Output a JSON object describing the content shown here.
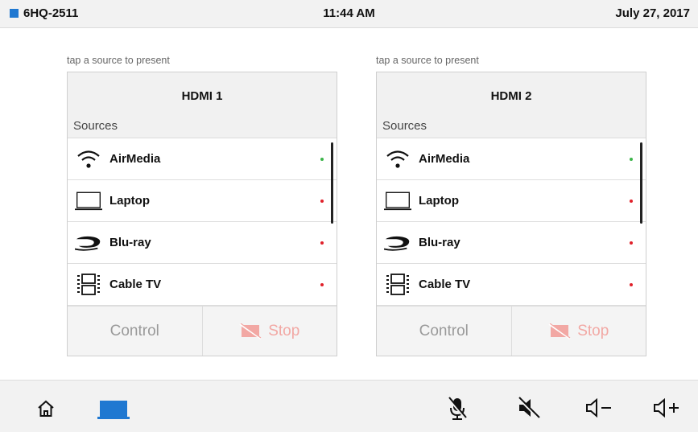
{
  "status_bar": {
    "room_name": "6HQ-2511",
    "time": "11:44 AM",
    "date": "July 27, 2017"
  },
  "panels": [
    {
      "hint": "tap a source to present",
      "title": "HDMI 1",
      "sources_label": "Sources",
      "sources": [
        {
          "label": "AirMedia",
          "icon": "wifi-icon",
          "status": "green"
        },
        {
          "label": "Laptop",
          "icon": "laptop-icon",
          "status": "red"
        },
        {
          "label": "Blu-ray",
          "icon": "bluray-icon",
          "status": "red"
        },
        {
          "label": "Cable TV",
          "icon": "cable-tv-icon",
          "status": "red"
        }
      ],
      "control_label": "Control",
      "stop_label": "Stop"
    },
    {
      "hint": "tap a source to present",
      "title": "HDMI 2",
      "sources_label": "Sources",
      "sources": [
        {
          "label": "AirMedia",
          "icon": "wifi-icon",
          "status": "green"
        },
        {
          "label": "Laptop",
          "icon": "laptop-icon",
          "status": "red"
        },
        {
          "label": "Blu-ray",
          "icon": "bluray-icon",
          "status": "red"
        },
        {
          "label": "Cable TV",
          "icon": "cable-tv-icon",
          "status": "red"
        }
      ],
      "control_label": "Control",
      "stop_label": "Stop"
    }
  ],
  "bottom_bar": {
    "icons": [
      "home-icon",
      "display-icon",
      "mic-mute-icon",
      "speaker-mute-icon",
      "volume-down-icon",
      "volume-up-icon"
    ]
  },
  "colors": {
    "accent": "#1f78d1",
    "status_green": "#3cb54a",
    "status_red": "#e0202a",
    "stop_disabled": "#f2a8a4"
  }
}
